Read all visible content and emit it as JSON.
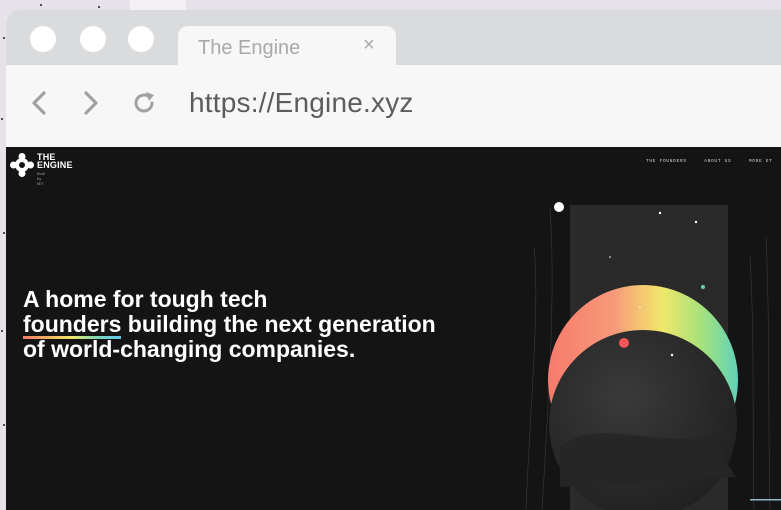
{
  "browser": {
    "tab": {
      "title": "The Engine",
      "close_label": "×"
    },
    "address_bar": {
      "url": "https://Engine.xyz"
    },
    "nav": {
      "back_icon": "chevron-left",
      "forward_icon": "chevron-right",
      "reload_icon": "reload"
    }
  },
  "site": {
    "logo": {
      "line1": "THE",
      "line2": "ENGINE",
      "subtitle": "Built by MIT"
    },
    "nav_items": [
      "THE FOUNDERS",
      "ABOUT US",
      "MORE ET"
    ],
    "headline": {
      "part1": "A home for tough tech",
      "highlight": "founders",
      "part2": "building the next generation of world-changing companies."
    }
  },
  "colors": {
    "page_bg": "#141414",
    "chrome_bar": "#d9dbdd",
    "accent_gradient": [
      "#f77a6b",
      "#f3b15f",
      "#f0e86a",
      "#7fd9b9",
      "#5fc6f0"
    ]
  }
}
